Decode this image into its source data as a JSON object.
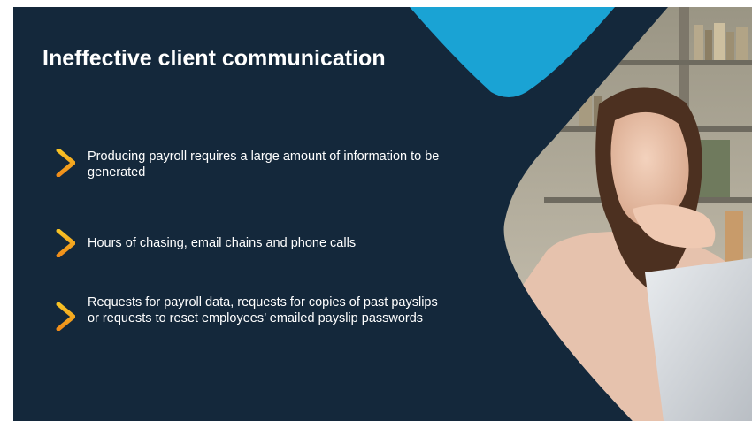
{
  "slide": {
    "title": "Ineffective client communication",
    "bullets": [
      {
        "text": "Producing payroll requires a large amount of information to be generated",
        "icon": "chevron-right-icon"
      },
      {
        "text": "Hours of chasing, email chains and phone calls",
        "icon": "chevron-right-icon"
      },
      {
        "text": "Requests for payroll data, requests for copies of past payslips or requests to reset employees’ emailed payslip passwords",
        "icon": "chevron-right-icon"
      }
    ]
  },
  "colors": {
    "background": "#14283b",
    "accent_blue": "#1aa3d4",
    "chevron_top": "#f7c325",
    "chevron_bottom": "#f08c1a",
    "text": "#ffffff"
  }
}
